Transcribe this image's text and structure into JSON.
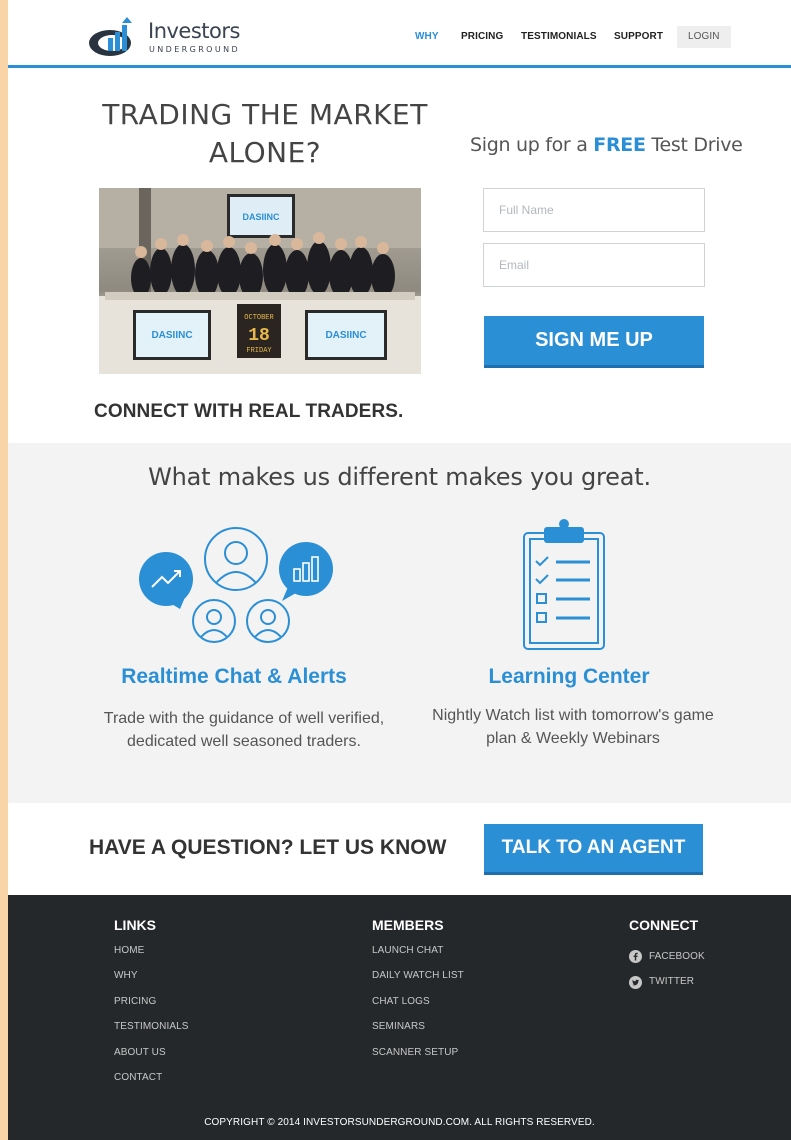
{
  "brand": {
    "name": "Investors",
    "sub": "UNDERGROUND",
    "accent": "#2b8fd6"
  },
  "nav": {
    "items": [
      "WHY",
      "PRICING",
      "TESTIMONIALS",
      "SUPPORT"
    ],
    "login": "LOGIN"
  },
  "hero": {
    "title_line1": "TRADING THE MARKET",
    "title_line2": "ALONE?",
    "tagline": "CONNECT WITH REAL TRADERS.",
    "photo": {
      "banner": "DASIINC",
      "ticker_month": "OCTOBER",
      "ticker_day": "18",
      "ticker_weekday": "FRIDAY"
    }
  },
  "signup": {
    "title_pre": "Sign up for a",
    "title_highlight": "FREE",
    "title_post": "Test Drive",
    "name_placeholder": "Full Name",
    "email_placeholder": "Email",
    "button": "SIGN ME UP"
  },
  "features": {
    "title": "What makes us different makes you great.",
    "items": [
      {
        "title": "Realtime Chat & Alerts",
        "text": "Trade with the guidance of well verified, dedicated well seasoned traders.",
        "icon": "chat-people-icon"
      },
      {
        "title": "Learning Center",
        "text": "Nightly Watch list with tomorrow's game plan & Weekly Webinars",
        "icon": "clipboard-checklist-icon"
      }
    ]
  },
  "cta": {
    "text": "HAVE A QUESTION? LET US KNOW",
    "button": "TALK TO AN AGENT"
  },
  "footer": {
    "links": {
      "heading": "LINKS",
      "items": [
        "HOME",
        "WHY",
        "PRICING",
        "TESTIMONIALS",
        "ABOUT US",
        "CONTACT"
      ]
    },
    "members": {
      "heading": "MEMBERS",
      "items": [
        "LAUNCH CHAT",
        "DAILY WATCH LIST",
        "CHAT LOGS",
        "SEMINARS",
        "SCANNER SETUP"
      ]
    },
    "connect": {
      "heading": "CONNECT",
      "items": [
        {
          "label": "FACEBOOK",
          "icon": "facebook-icon"
        },
        {
          "label": "TWITTER",
          "icon": "twitter-icon"
        }
      ]
    },
    "copyright": "COPYRIGHT © 2014 INVESTORSUNDERGROUND.COM. ALL RIGHTS RESERVED."
  }
}
